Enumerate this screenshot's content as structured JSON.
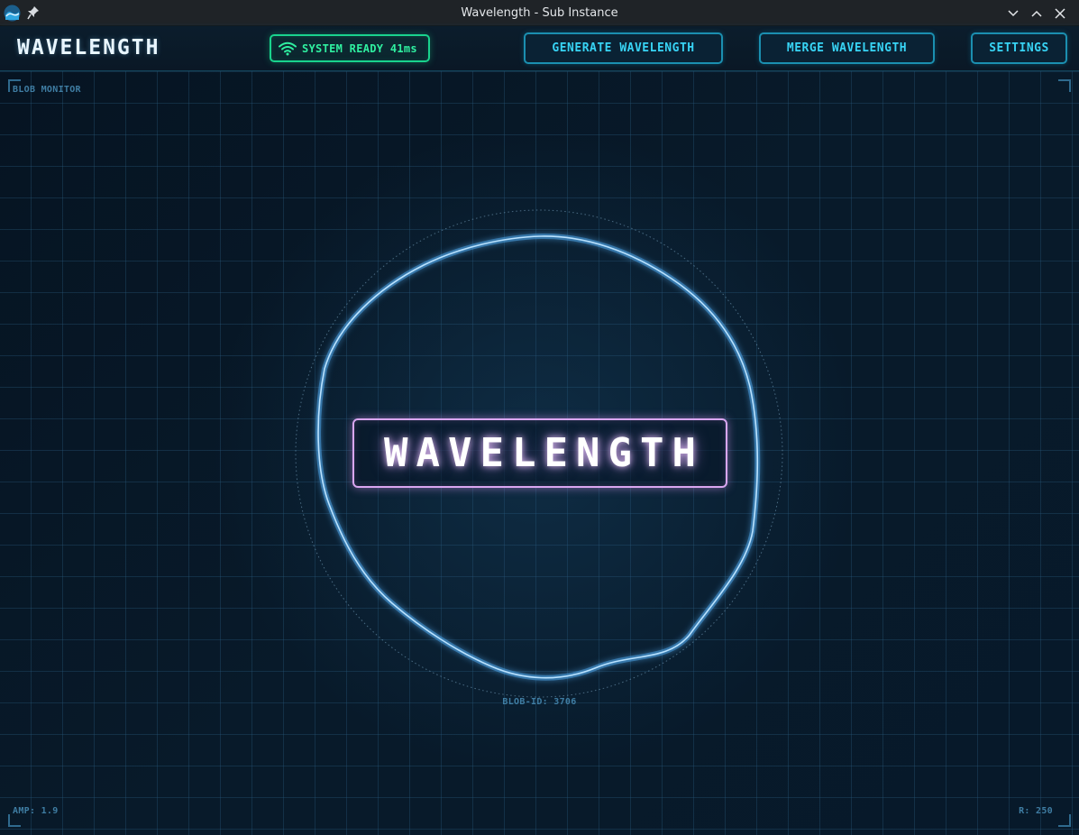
{
  "window": {
    "title": "Wavelength - Sub Instance",
    "app_icon": "wave-app-icon",
    "pin_icon": "pin-icon",
    "controls": [
      "minimize-icon",
      "maximize-icon",
      "close-icon"
    ]
  },
  "header": {
    "logo": "WAVELENGTH",
    "status": {
      "text": "SYSTEM READY 41ms",
      "icon": "wifi-icon",
      "color": "#19d38d"
    },
    "buttons": {
      "generate": "GENERATE WAVELENGTH",
      "merge": "MERGE WAVELENGTH",
      "settings": "SETTINGS"
    },
    "accent_color": "#38d4f5"
  },
  "monitor": {
    "title": "BLOB MONITOR",
    "center_title": "WAVELENGTH",
    "blob_id": "BLOB-ID: 3706",
    "amp": "AMP: 1.9",
    "radius": "R: 250",
    "blob_color": "#5aa8e6",
    "title_border_color": "#d9a6f0"
  }
}
